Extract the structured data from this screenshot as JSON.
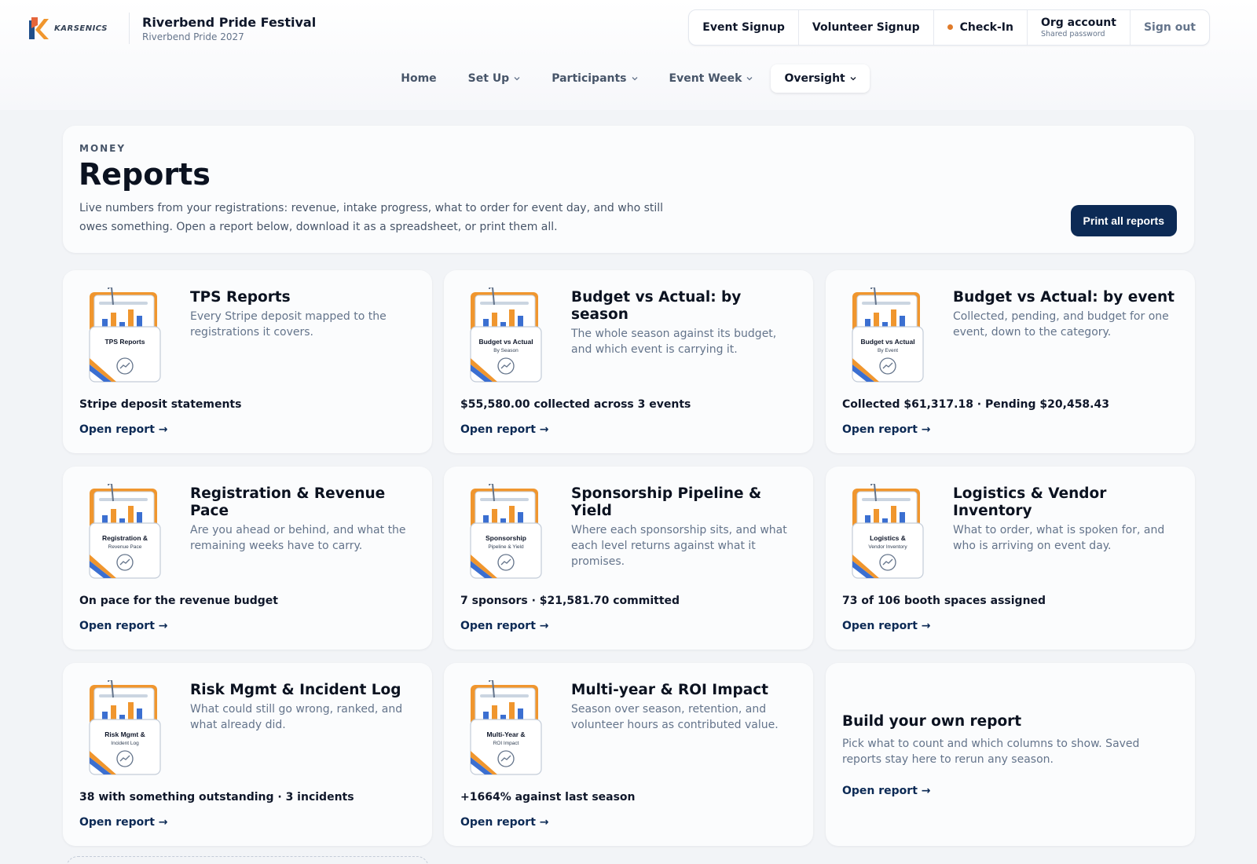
{
  "brand": {
    "logo_text": "KARSENICS",
    "title": "Riverbend Pride Festival",
    "subtitle": "Riverbend Pride 2027"
  },
  "actions": {
    "event_signup": "Event Signup",
    "volunteer_signup": "Volunteer Signup",
    "check_in": "Check-In",
    "org_account": "Org account",
    "org_account_sub": "Shared password",
    "sign_out": "Sign out"
  },
  "nav": {
    "home": "Home",
    "setup": "Set Up",
    "participants": "Participants",
    "event_week": "Event Week",
    "oversight": "Oversight"
  },
  "hero": {
    "eyebrow": "MONEY",
    "title": "Reports",
    "description": "Live numbers from your registrations: revenue, intake progress, what to order for event day, and who still owes something. Open a report below, download it as a spreadsheet, or print them all.",
    "print_button": "Print all reports"
  },
  "open_label": "Open report →",
  "reports": [
    {
      "title": "TPS Reports",
      "description": "Every Stripe deposit mapped to the registrations it covers.",
      "stat": "Stripe deposit statements",
      "thumb_label": "TPS Reports",
      "thumb_sub": ""
    },
    {
      "title": "Budget vs Actual: by season",
      "description": "The whole season against its budget, and which event is carrying it.",
      "stat": "$55,580.00 collected across 3 events",
      "thumb_label": "Budget vs Actual",
      "thumb_sub": "By Season"
    },
    {
      "title": "Budget vs Actual: by event",
      "description": "Collected, pending, and budget for one event, down to the category.",
      "stat": "Collected $61,317.18 · Pending $20,458.43",
      "thumb_label": "Budget vs Actual",
      "thumb_sub": "By Event"
    },
    {
      "title": "Registration & Revenue Pace",
      "description": "Are you ahead or behind, and what the remaining weeks have to carry.",
      "stat": "On pace for the revenue budget",
      "thumb_label": "Registration &",
      "thumb_sub": "Revenue Pace"
    },
    {
      "title": "Sponsorship Pipeline & Yield",
      "description": "Where each sponsorship sits, and what each level returns against what it promises.",
      "stat": "7 sponsors · $21,581.70 committed",
      "thumb_label": "Sponsorship",
      "thumb_sub": "Pipeline & Yield"
    },
    {
      "title": "Logistics & Vendor Inventory",
      "description": "What to order, what is spoken for, and who is arriving on event day.",
      "stat": "73 of 106 booth spaces assigned",
      "thumb_label": "Logistics &",
      "thumb_sub": "Vendor Inventory"
    },
    {
      "title": "Risk Mgmt & Incident Log",
      "description": "What could still go wrong, ranked, and what already did.",
      "stat": "38 with something outstanding · 3 incidents",
      "thumb_label": "Risk Mgmt &",
      "thumb_sub": "Incident Log"
    },
    {
      "title": "Multi-year & ROI Impact",
      "description": "Season over season, retention, and volunteer hours as contributed value.",
      "stat": "+1664% against last season",
      "thumb_label": "Multi-Year &",
      "thumb_sub": "ROI Impact"
    }
  ],
  "custom_report": {
    "title": "Build your own report",
    "description": "Pick what to count and which columns to show. Saved reports stay here to rerun any season."
  },
  "colors": {
    "primary_navy": "#0c2a55",
    "accent_orange": "#f0962e",
    "accent_blue": "#3b6fd1",
    "status_dot": "#e07b2a"
  },
  "icons": {
    "cursor": "mouse-pointer-icon",
    "chevron": "chevron-down-icon",
    "check_in_dot": "status-dot-icon",
    "report_thumb": "report-folder-icon"
  }
}
